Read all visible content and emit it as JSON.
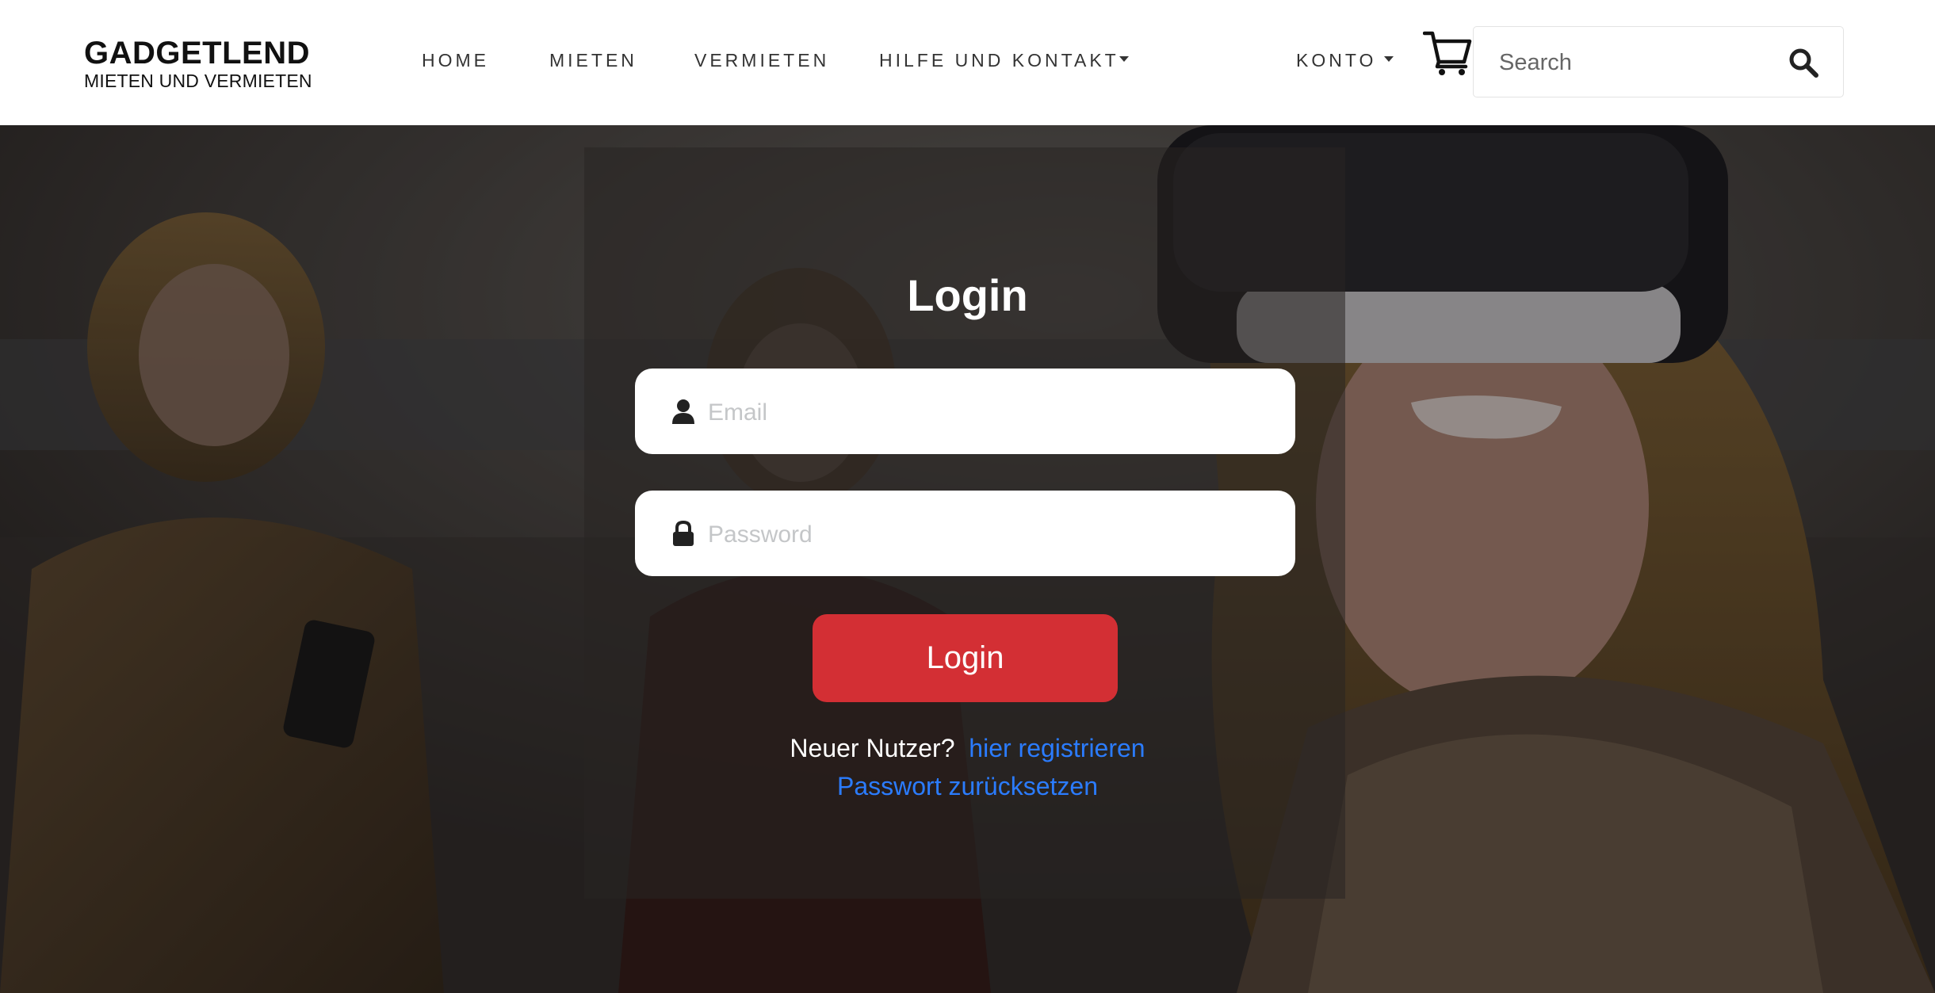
{
  "header": {
    "brand_name": "GADGETLEND",
    "brand_tagline": "MIETEN UND VERMIETEN",
    "nav": [
      {
        "label": "HOME"
      },
      {
        "label": "MIETEN"
      },
      {
        "label": "VERMIETEN"
      },
      {
        "label": "HILFE UND KONTAKT"
      }
    ],
    "account_label": "KONTO",
    "cart_icon": "shopping-cart-icon",
    "search_placeholder": "Search",
    "search_icon": "magnifier-icon"
  },
  "login": {
    "title": "Login",
    "email_placeholder": "Email",
    "email_icon": "user-icon",
    "password_placeholder": "Password",
    "password_icon": "lock-icon",
    "submit_label": "Login",
    "new_user_text": "Neuer Nutzer?",
    "register_link": "hier registrieren",
    "reset_link": "Passwort zurücksetzen"
  },
  "colors": {
    "accent_red": "#d32f34",
    "link_blue": "#2b7cff",
    "header_bg": "#ffffff"
  }
}
